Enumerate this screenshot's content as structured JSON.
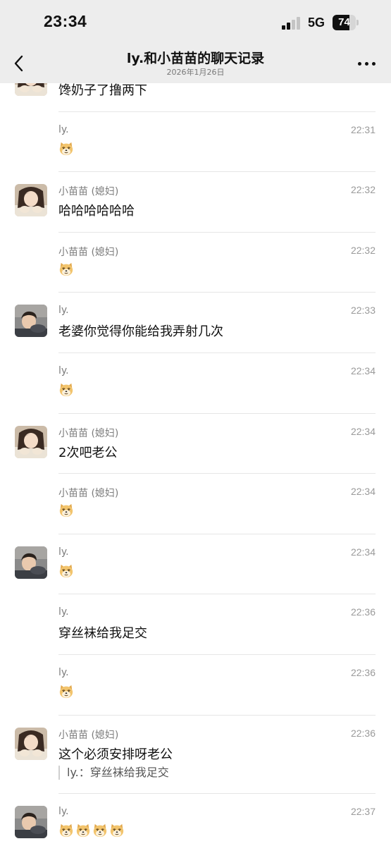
{
  "status_bar": {
    "time": "23:34",
    "network": "5G",
    "battery_level": "74"
  },
  "nav": {
    "title": "ly.和小苗苗的聊天记录",
    "subtitle": "2026年1月26日",
    "back_icon": "chevron-left-icon",
    "more_icon": "more-dots-icon"
  },
  "colors": {
    "header_bg": "#ededed",
    "sender_text": "#7d7d7d",
    "time_text": "#9a9a9a",
    "divider": "#e6e6e6"
  },
  "messages": [
    {
      "sender": "",
      "avatar": "xiaomiaomiao",
      "time": "",
      "text": "馋奶子了撸两下",
      "emoji_count": 0,
      "quote": ""
    },
    {
      "sender": "ly.",
      "avatar": "",
      "time": "22:31",
      "text": "",
      "emoji_count": 1,
      "quote": ""
    },
    {
      "sender": "小苗苗 (媳妇)",
      "avatar": "xiaomiaomiao",
      "time": "22:32",
      "text": "哈哈哈哈哈哈",
      "emoji_count": 0,
      "quote": ""
    },
    {
      "sender": "小苗苗 (媳妇)",
      "avatar": "",
      "time": "22:32",
      "text": "",
      "emoji_count": 1,
      "quote": ""
    },
    {
      "sender": "ly.",
      "avatar": "ly",
      "time": "22:33",
      "text": "老婆你觉得你能给我弄射几次",
      "emoji_count": 0,
      "quote": ""
    },
    {
      "sender": "ly.",
      "avatar": "",
      "time": "22:34",
      "text": "",
      "emoji_count": 1,
      "quote": ""
    },
    {
      "sender": "小苗苗 (媳妇)",
      "avatar": "xiaomiaomiao",
      "time": "22:34",
      "text": "2次吧老公",
      "emoji_count": 0,
      "quote": ""
    },
    {
      "sender": "小苗苗 (媳妇)",
      "avatar": "",
      "time": "22:34",
      "text": "",
      "emoji_count": 1,
      "quote": ""
    },
    {
      "sender": "ly.",
      "avatar": "ly",
      "time": "22:34",
      "text": "",
      "emoji_count": 1,
      "quote": ""
    },
    {
      "sender": "ly.",
      "avatar": "",
      "time": "22:36",
      "text": "穿丝袜给我足交",
      "emoji_count": 0,
      "quote": ""
    },
    {
      "sender": "ly.",
      "avatar": "",
      "time": "22:36",
      "text": "",
      "emoji_count": 1,
      "quote": ""
    },
    {
      "sender": "小苗苗 (媳妇)",
      "avatar": "xiaomiaomiao",
      "time": "22:36",
      "text": "这个必须安排呀老公",
      "emoji_count": 0,
      "quote": "ly.：穿丝袜给我足交"
    },
    {
      "sender": "ly.",
      "avatar": "ly",
      "time": "22:37",
      "text": "",
      "emoji_count": 4,
      "quote": ""
    }
  ]
}
